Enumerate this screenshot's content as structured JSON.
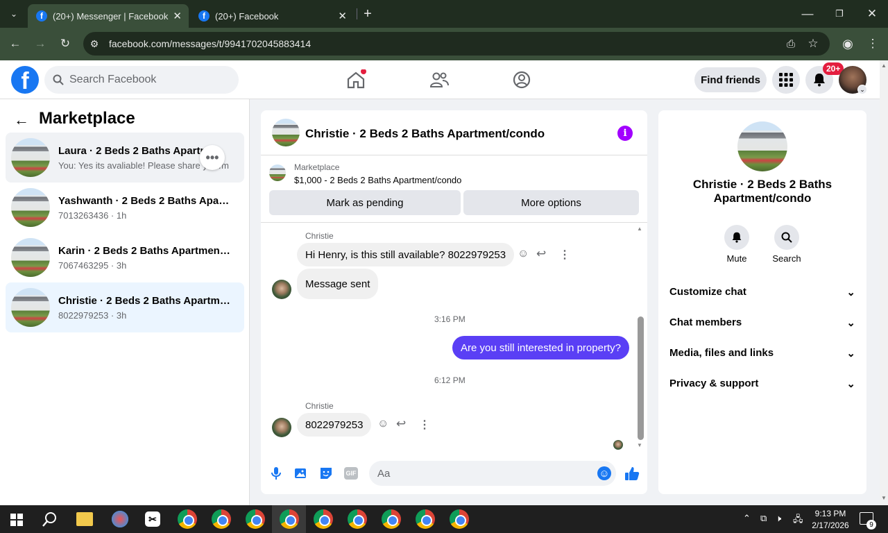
{
  "browser": {
    "tabs": [
      {
        "title": "(20+) Messenger | Facebook"
      },
      {
        "title": "(20+) Facebook"
      }
    ],
    "url": "facebook.com/messages/t/9941702045883414",
    "new_tab_symbol": "+"
  },
  "header": {
    "logo_letter": "f",
    "search_placeholder": "Search Facebook",
    "find_friends": "Find friends",
    "notifications_badge": "20+"
  },
  "left_panel": {
    "title": "Marketplace",
    "conversations": [
      {
        "title": "Laura · 2 Beds 2 Baths Apartm…",
        "preview": "You: Yes its avaliable! Please share yo…m"
      },
      {
        "title": "Yashwanth · 2 Beds 2 Baths Apart...",
        "preview": "7013263436 · 1h"
      },
      {
        "title": "Karin · 2 Beds 2 Baths Apartment/...",
        "preview": "7067463295 · 3h"
      },
      {
        "title": "Christie · 2 Beds 2 Baths Apartmen...",
        "preview": "8022979253 · 3h"
      }
    ]
  },
  "chat": {
    "title": "Christie · 2 Beds 2 Baths Apartment/condo",
    "listing_source": "Marketplace",
    "listing_desc": "$1,000 - 2 Beds 2 Baths Apartment/condo",
    "mark_pending": "Mark as pending",
    "more_options": "More options",
    "messages": {
      "sender1": "Christie",
      "msg1": "Hi Henry, is this still available? 8022979253",
      "msg2": "Message sent",
      "time1": "3:16 PM",
      "msg3": "Are you still interested in property?",
      "time2": "6:12 PM",
      "sender2": "Christie",
      "msg4": "8022979253"
    },
    "composer_placeholder": "Aa",
    "gif_label": "GIF"
  },
  "right_panel": {
    "title": "Christie · 2 Beds 2 Baths Apartment/condo",
    "mute": "Mute",
    "search": "Search",
    "sections": [
      {
        "label": "Customize chat"
      },
      {
        "label": "Chat members"
      },
      {
        "label": "Media, files and links"
      },
      {
        "label": "Privacy & support"
      }
    ]
  },
  "taskbar": {
    "time": "9:13 PM",
    "date": "2/17/2026",
    "notif_count": "9"
  },
  "colors": {
    "messenger_purple": "#5a3ff5",
    "fb_blue": "#1877f2",
    "selected_conv": "#ebf5ff"
  }
}
